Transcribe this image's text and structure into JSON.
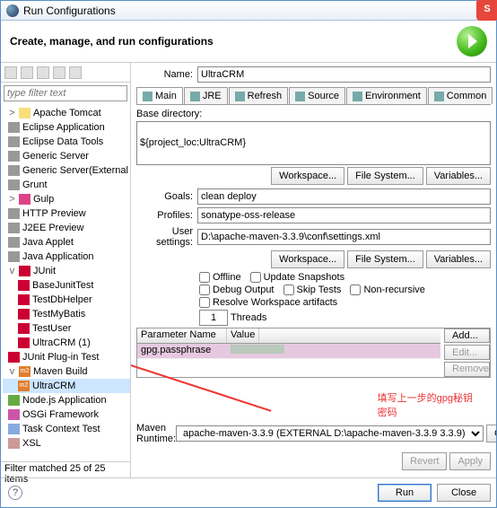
{
  "window": {
    "title": "Run Configurations"
  },
  "header": {
    "title": "Create, manage, and run configurations"
  },
  "left": {
    "filter_placeholder": "type filter text",
    "nodes": [
      {
        "l": "Apache Tomcat",
        "d": 0,
        "ic": "cat",
        "tw": ">"
      },
      {
        "l": "Eclipse Application",
        "d": 0,
        "ic": "gr"
      },
      {
        "l": "Eclipse Data Tools",
        "d": 0,
        "ic": "gr"
      },
      {
        "l": "Generic Server",
        "d": 0,
        "ic": "gr"
      },
      {
        "l": "Generic Server(External",
        "d": 0,
        "ic": "gr"
      },
      {
        "l": "Grunt",
        "d": 0,
        "ic": "gr"
      },
      {
        "l": "Gulp",
        "d": 0,
        "ic": "gl",
        "tw": ">"
      },
      {
        "l": "HTTP Preview",
        "d": 0,
        "ic": "gr"
      },
      {
        "l": "J2EE Preview",
        "d": 0,
        "ic": "gr"
      },
      {
        "l": "Java Applet",
        "d": 0,
        "ic": "gr"
      },
      {
        "l": "Java Application",
        "d": 0,
        "ic": "gr"
      },
      {
        "l": "JUnit",
        "d": 0,
        "ic": "ju",
        "tw": "v"
      },
      {
        "l": "BaseJunitTest",
        "d": 1,
        "ic": "ju"
      },
      {
        "l": "TestDbHelper",
        "d": 1,
        "ic": "ju"
      },
      {
        "l": "TestMyBatis",
        "d": 1,
        "ic": "ju"
      },
      {
        "l": "TestUser",
        "d": 1,
        "ic": "ju"
      },
      {
        "l": "UltraCRM (1)",
        "d": 1,
        "ic": "ju"
      },
      {
        "l": "JUnit Plug-in Test",
        "d": 0,
        "ic": "ju"
      },
      {
        "l": "Maven Build",
        "d": 0,
        "ic": "m2",
        "tw": "v"
      },
      {
        "l": "UltraCRM",
        "d": 1,
        "ic": "m2",
        "sel": true
      },
      {
        "l": "Node.js Application",
        "d": 0,
        "ic": "nj"
      },
      {
        "l": "OSGi Framework",
        "d": 0,
        "ic": "os"
      },
      {
        "l": "Task Context Test",
        "d": 0,
        "ic": "tc"
      },
      {
        "l": "XSL",
        "d": 0,
        "ic": "xs"
      }
    ],
    "status": "Filter matched 25 of 25 items"
  },
  "main": {
    "name_label": "Name:",
    "name_value": "UltraCRM",
    "tabs": [
      "Main",
      "JRE",
      "Refresh",
      "Source",
      "Environment",
      "Common"
    ],
    "basedir_label": "Base directory:",
    "basedir_value": "${project_loc:UltraCRM}",
    "btn_workspace": "Workspace...",
    "btn_filesystem": "File System...",
    "btn_variables": "Variables...",
    "goals_label": "Goals:",
    "goals_value": "clean deploy",
    "profiles_label": "Profiles:",
    "profiles_value": "sonatype-oss-release",
    "usersettings_label": "User settings:",
    "usersettings_value": "D:\\apache-maven-3.3.9\\conf\\settings.xml",
    "chk_offline": "Offline",
    "chk_update": "Update Snapshots",
    "chk_debug": "Debug Output",
    "chk_skip": "Skip Tests",
    "chk_nonrec": "Non-recursive",
    "chk_resolve": "Resolve Workspace artifacts",
    "threads_label": "Threads",
    "threads_value": "1",
    "col_param": "Parameter Name",
    "col_value": "Value",
    "param_row": {
      "name": "gpg.passphrase"
    },
    "btn_add": "Add...",
    "btn_edit": "Edit...",
    "btn_remove": "Remove",
    "maven_label": "Maven Runtime:",
    "maven_value": "apache-maven-3.3.9 (EXTERNAL D:\\apache-maven-3.3.9 3.3.9)",
    "btn_configure": "Configure...",
    "btn_revert": "Revert",
    "btn_apply": "Apply"
  },
  "bottom": {
    "run": "Run",
    "close": "Close"
  },
  "annotation": "填写上一步的gpg秘钥\n密码",
  "ext_logo": "S"
}
